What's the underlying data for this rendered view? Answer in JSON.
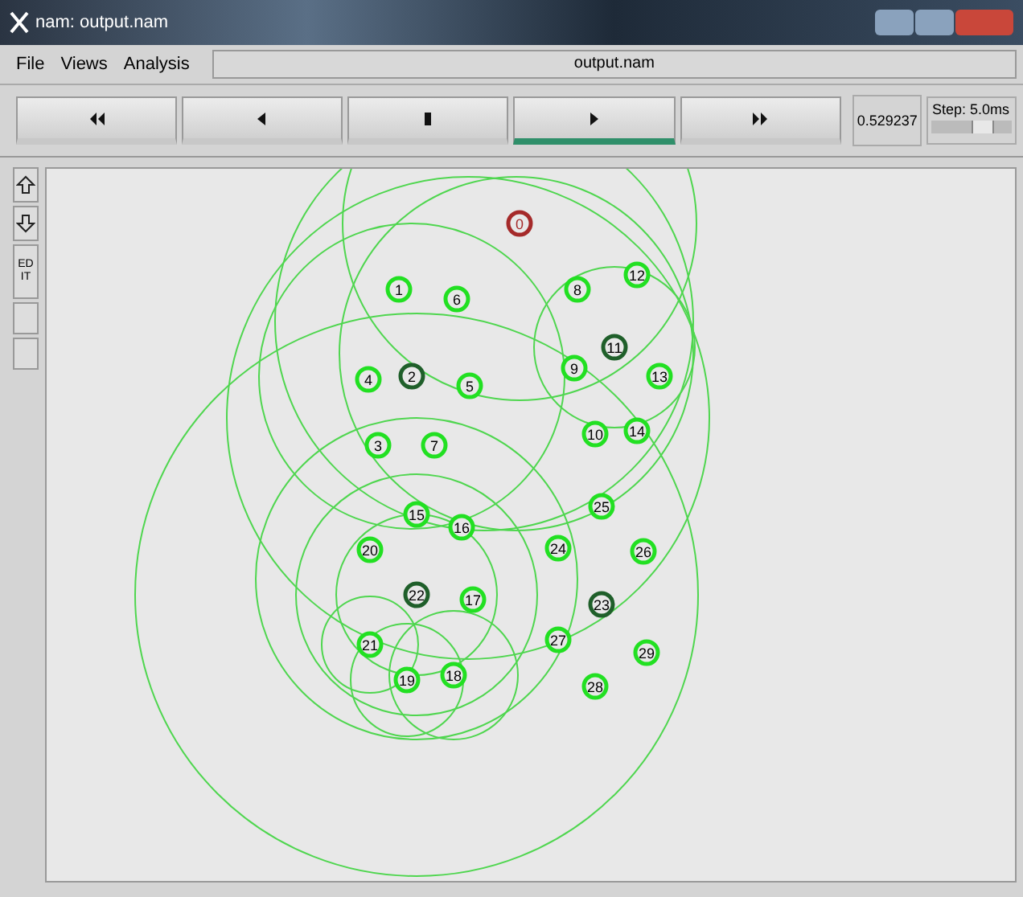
{
  "window": {
    "title": "nam: output.nam"
  },
  "menu": [
    "File",
    "Views",
    "Analysis"
  ],
  "filename": "output.nam",
  "transport": [
    {
      "kind": "rewind",
      "selected": false
    },
    {
      "kind": "back",
      "selected": false
    },
    {
      "kind": "stop",
      "selected": false
    },
    {
      "kind": "play",
      "selected": true
    },
    {
      "kind": "forward",
      "selected": false
    }
  ],
  "time": "0.529237",
  "step": {
    "label": "Step: 5.0ms",
    "level": 0.7
  },
  "side_tools": [
    {
      "kind": "zoom-in"
    },
    {
      "kind": "zoom-out"
    },
    {
      "kind": "edit",
      "label": "ED IT"
    },
    {
      "kind": "blank"
    },
    {
      "kind": "blank"
    }
  ],
  "nodes": [
    {
      "label": "0",
      "kind": "sink"
    },
    {
      "label": "1",
      "kind": "sensor"
    },
    {
      "label": "2",
      "kind": "head"
    },
    {
      "label": "3",
      "kind": "sensor"
    },
    {
      "label": "4",
      "kind": "sensor"
    },
    {
      "label": "5",
      "kind": "sensor"
    },
    {
      "label": "6",
      "kind": "sensor"
    },
    {
      "label": "7",
      "kind": "sensor"
    },
    {
      "label": "8",
      "kind": "sensor"
    },
    {
      "label": "9",
      "kind": "sensor"
    },
    {
      "label": "10",
      "kind": "sensor"
    },
    {
      "label": "11",
      "kind": "head"
    },
    {
      "label": "12",
      "kind": "sensor"
    },
    {
      "label": "13",
      "kind": "sensor"
    },
    {
      "label": "14",
      "kind": "sensor"
    },
    {
      "label": "15",
      "kind": "sensor"
    },
    {
      "label": "16",
      "kind": "sensor"
    },
    {
      "label": "17",
      "kind": "sensor"
    },
    {
      "label": "18",
      "kind": "sensor"
    },
    {
      "label": "19",
      "kind": "sensor"
    },
    {
      "label": "20",
      "kind": "sensor"
    },
    {
      "label": "21",
      "kind": "sensor"
    },
    {
      "label": "22",
      "kind": "head"
    },
    {
      "label": "23",
      "kind": "head"
    },
    {
      "label": "24",
      "kind": "sensor"
    },
    {
      "label": "25",
      "kind": "sensor"
    },
    {
      "label": "26",
      "kind": "sensor"
    },
    {
      "label": "27",
      "kind": "sensor"
    },
    {
      "label": "28",
      "kind": "sensor"
    },
    {
      "label": "29",
      "kind": "sensor"
    }
  ]
}
